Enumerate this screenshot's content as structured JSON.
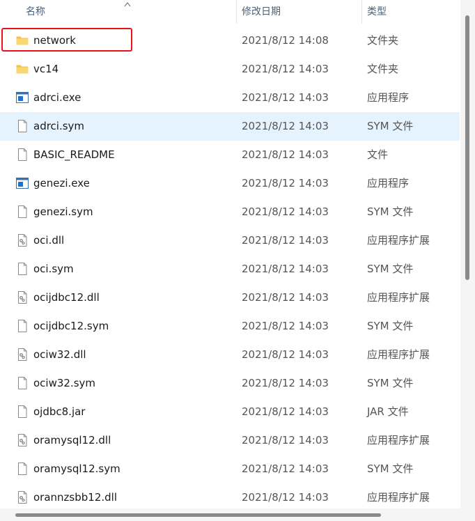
{
  "header": {
    "name_col": "名称",
    "date_col": "修改日期",
    "type_col": "类型"
  },
  "files": [
    {
      "name": "network",
      "date": "2021/8/12 14:08",
      "type": "文件夹",
      "icon": "folder-icon"
    },
    {
      "name": "vc14",
      "date": "2021/8/12 14:03",
      "type": "文件夹",
      "icon": "folder-icon"
    },
    {
      "name": "adrci.exe",
      "date": "2021/8/12 14:03",
      "type": "应用程序",
      "icon": "exe-icon"
    },
    {
      "name": "adrci.sym",
      "date": "2021/8/12 14:03",
      "type": "SYM 文件",
      "icon": "file-icon"
    },
    {
      "name": "BASIC_README",
      "date": "2021/8/12 14:03",
      "type": "文件",
      "icon": "file-icon"
    },
    {
      "name": "genezi.exe",
      "date": "2021/8/12 14:03",
      "type": "应用程序",
      "icon": "exe-icon"
    },
    {
      "name": "genezi.sym",
      "date": "2021/8/12 14:03",
      "type": "SYM 文件",
      "icon": "file-icon"
    },
    {
      "name": "oci.dll",
      "date": "2021/8/12 14:03",
      "type": "应用程序扩展",
      "icon": "dll-icon"
    },
    {
      "name": "oci.sym",
      "date": "2021/8/12 14:03",
      "type": "SYM 文件",
      "icon": "file-icon"
    },
    {
      "name": "ocijdbc12.dll",
      "date": "2021/8/12 14:03",
      "type": "应用程序扩展",
      "icon": "dll-icon"
    },
    {
      "name": "ocijdbc12.sym",
      "date": "2021/8/12 14:03",
      "type": "SYM 文件",
      "icon": "file-icon"
    },
    {
      "name": "ociw32.dll",
      "date": "2021/8/12 14:03",
      "type": "应用程序扩展",
      "icon": "dll-icon"
    },
    {
      "name": "ociw32.sym",
      "date": "2021/8/12 14:03",
      "type": "SYM 文件",
      "icon": "file-icon"
    },
    {
      "name": "ojdbc8.jar",
      "date": "2021/8/12 14:03",
      "type": "JAR 文件",
      "icon": "file-icon"
    },
    {
      "name": "oramysql12.dll",
      "date": "2021/8/12 14:03",
      "type": "应用程序扩展",
      "icon": "dll-icon"
    },
    {
      "name": "oramysql12.sym",
      "date": "2021/8/12 14:03",
      "type": "SYM 文件",
      "icon": "file-icon"
    },
    {
      "name": "orannzsbb12.dll",
      "date": "2021/8/12 14:03",
      "type": "应用程序扩展",
      "icon": "dll-icon"
    }
  ],
  "hovered_row": 3,
  "highlighted_row": 0,
  "colors": {
    "hover_bg": "#e5f3ff",
    "highlight_border": "#e8141a",
    "folder": "#f8d775",
    "header_text": "#4c607a"
  }
}
